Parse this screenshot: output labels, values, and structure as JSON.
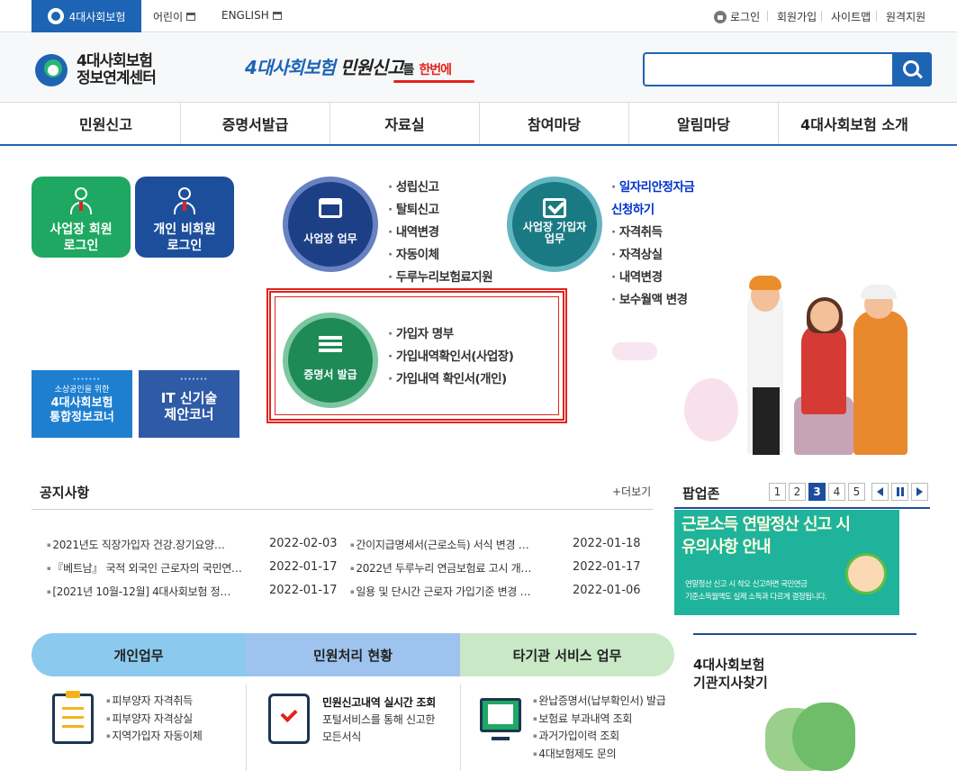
{
  "top": {
    "site_tab": "4대사회보험",
    "kids": "어린이",
    "english": "ENGLISH",
    "login": "로그인",
    "join": "회원가입",
    "sitemap": "사이트맵",
    "remote": "원격지원"
  },
  "header": {
    "brand_line1": "4대사회보험",
    "brand_line2": "정보연계센터",
    "slogan_a": "4대사회보험",
    "slogan_b": "민원신고",
    "slogan_c": "를",
    "slogan_d": "한번에",
    "search_value": ""
  },
  "gnb": [
    "민원신고",
    "증명서발급",
    "자료실",
    "참여마당",
    "알림마당",
    "4대사회보험 소개"
  ],
  "login_tiles": {
    "biz": [
      "사업장 회원",
      "로그인"
    ],
    "personal": [
      "개인 비회원",
      "로그인"
    ]
  },
  "banners": {
    "b1_dots": "·······",
    "b1_small": "소상공인을 위한",
    "b1_big1": "4대사회보험",
    "b1_big2": "통합정보코너",
    "b2_dots": "·······",
    "b2_big1": "IT 신기술",
    "b2_big2": "제안코너"
  },
  "services": {
    "biz": {
      "label": "사업장 업무",
      "items": [
        "성립신고",
        "탈퇴신고",
        "내역변경",
        "자동이체",
        "두루누리보험료지원"
      ]
    },
    "subscriber": {
      "label1": "사업장 가입자",
      "label2": "업무",
      "highlight1": "일자리안정자금",
      "highlight2": "신청하기",
      "items": [
        "자격취득",
        "자격상실",
        "내역변경",
        "보수월액 변경"
      ]
    },
    "cert": {
      "label": "증명서 발급",
      "items": [
        "가입자 명부",
        "가입내역확인서(사업장)",
        "가입내역 확인서(개인)"
      ]
    }
  },
  "notice": {
    "title": "공지사항",
    "more": "+더보기",
    "left": [
      {
        "title": "2021년도 직장가입자 건강.장기요양…",
        "date": "2022-02-03"
      },
      {
        "title": "『베트남』 국적 외국인 근로자의 국민연…",
        "date": "2022-01-17"
      },
      {
        "title": "[2021년 10월-12월] 4대사회보험 정…",
        "date": "2022-01-17"
      }
    ],
    "right": [
      {
        "title": "간이지급명세서(근로소득) 서식 변경 …",
        "date": "2022-01-18"
      },
      {
        "title": "2022년 두루누리 연금보험료 고시 개…",
        "date": "2022-01-17"
      },
      {
        "title": "일용 및 단시간 근로자 가입기준 변경 …",
        "date": "2022-01-06"
      }
    ]
  },
  "popup": {
    "title": "팝업존",
    "pages": [
      "1",
      "2",
      "3",
      "4",
      "5"
    ],
    "active_page": "3",
    "headline1": "근로소득 연말정산 신고 시",
    "headline2": "유의사항 안내",
    "text1": "연말정산 신고 시 착오 신고하면 국민연금",
    "text2": "기준소득월액도 실제 소득과 다르게 결정됩니다."
  },
  "bottom_tabs": [
    "개인업무",
    "민원처리 현황",
    "타기관 서비스 업무"
  ],
  "personal_items": [
    "피부양자 자격취득",
    "피부양자 자격상실",
    "지역가입자 자동이체"
  ],
  "status": {
    "title": "민원신고내역 실시간 조회",
    "desc1": "포털서비스를 통해 신고한",
    "desc2": "모든서식"
  },
  "other_items": [
    "완납증명서(납부확인서) 발급",
    "보험료 부과내역 조회",
    "과거가입이력 조회",
    "4대보험제도 문의"
  ],
  "agency": {
    "title1": "4대사회보험",
    "title2": "기관지사찾기"
  },
  "colors": {
    "primary": "#1d64b4",
    "green": "#1ea862",
    "navy": "#1d4e9c",
    "highlight_red": "#e2231a"
  }
}
